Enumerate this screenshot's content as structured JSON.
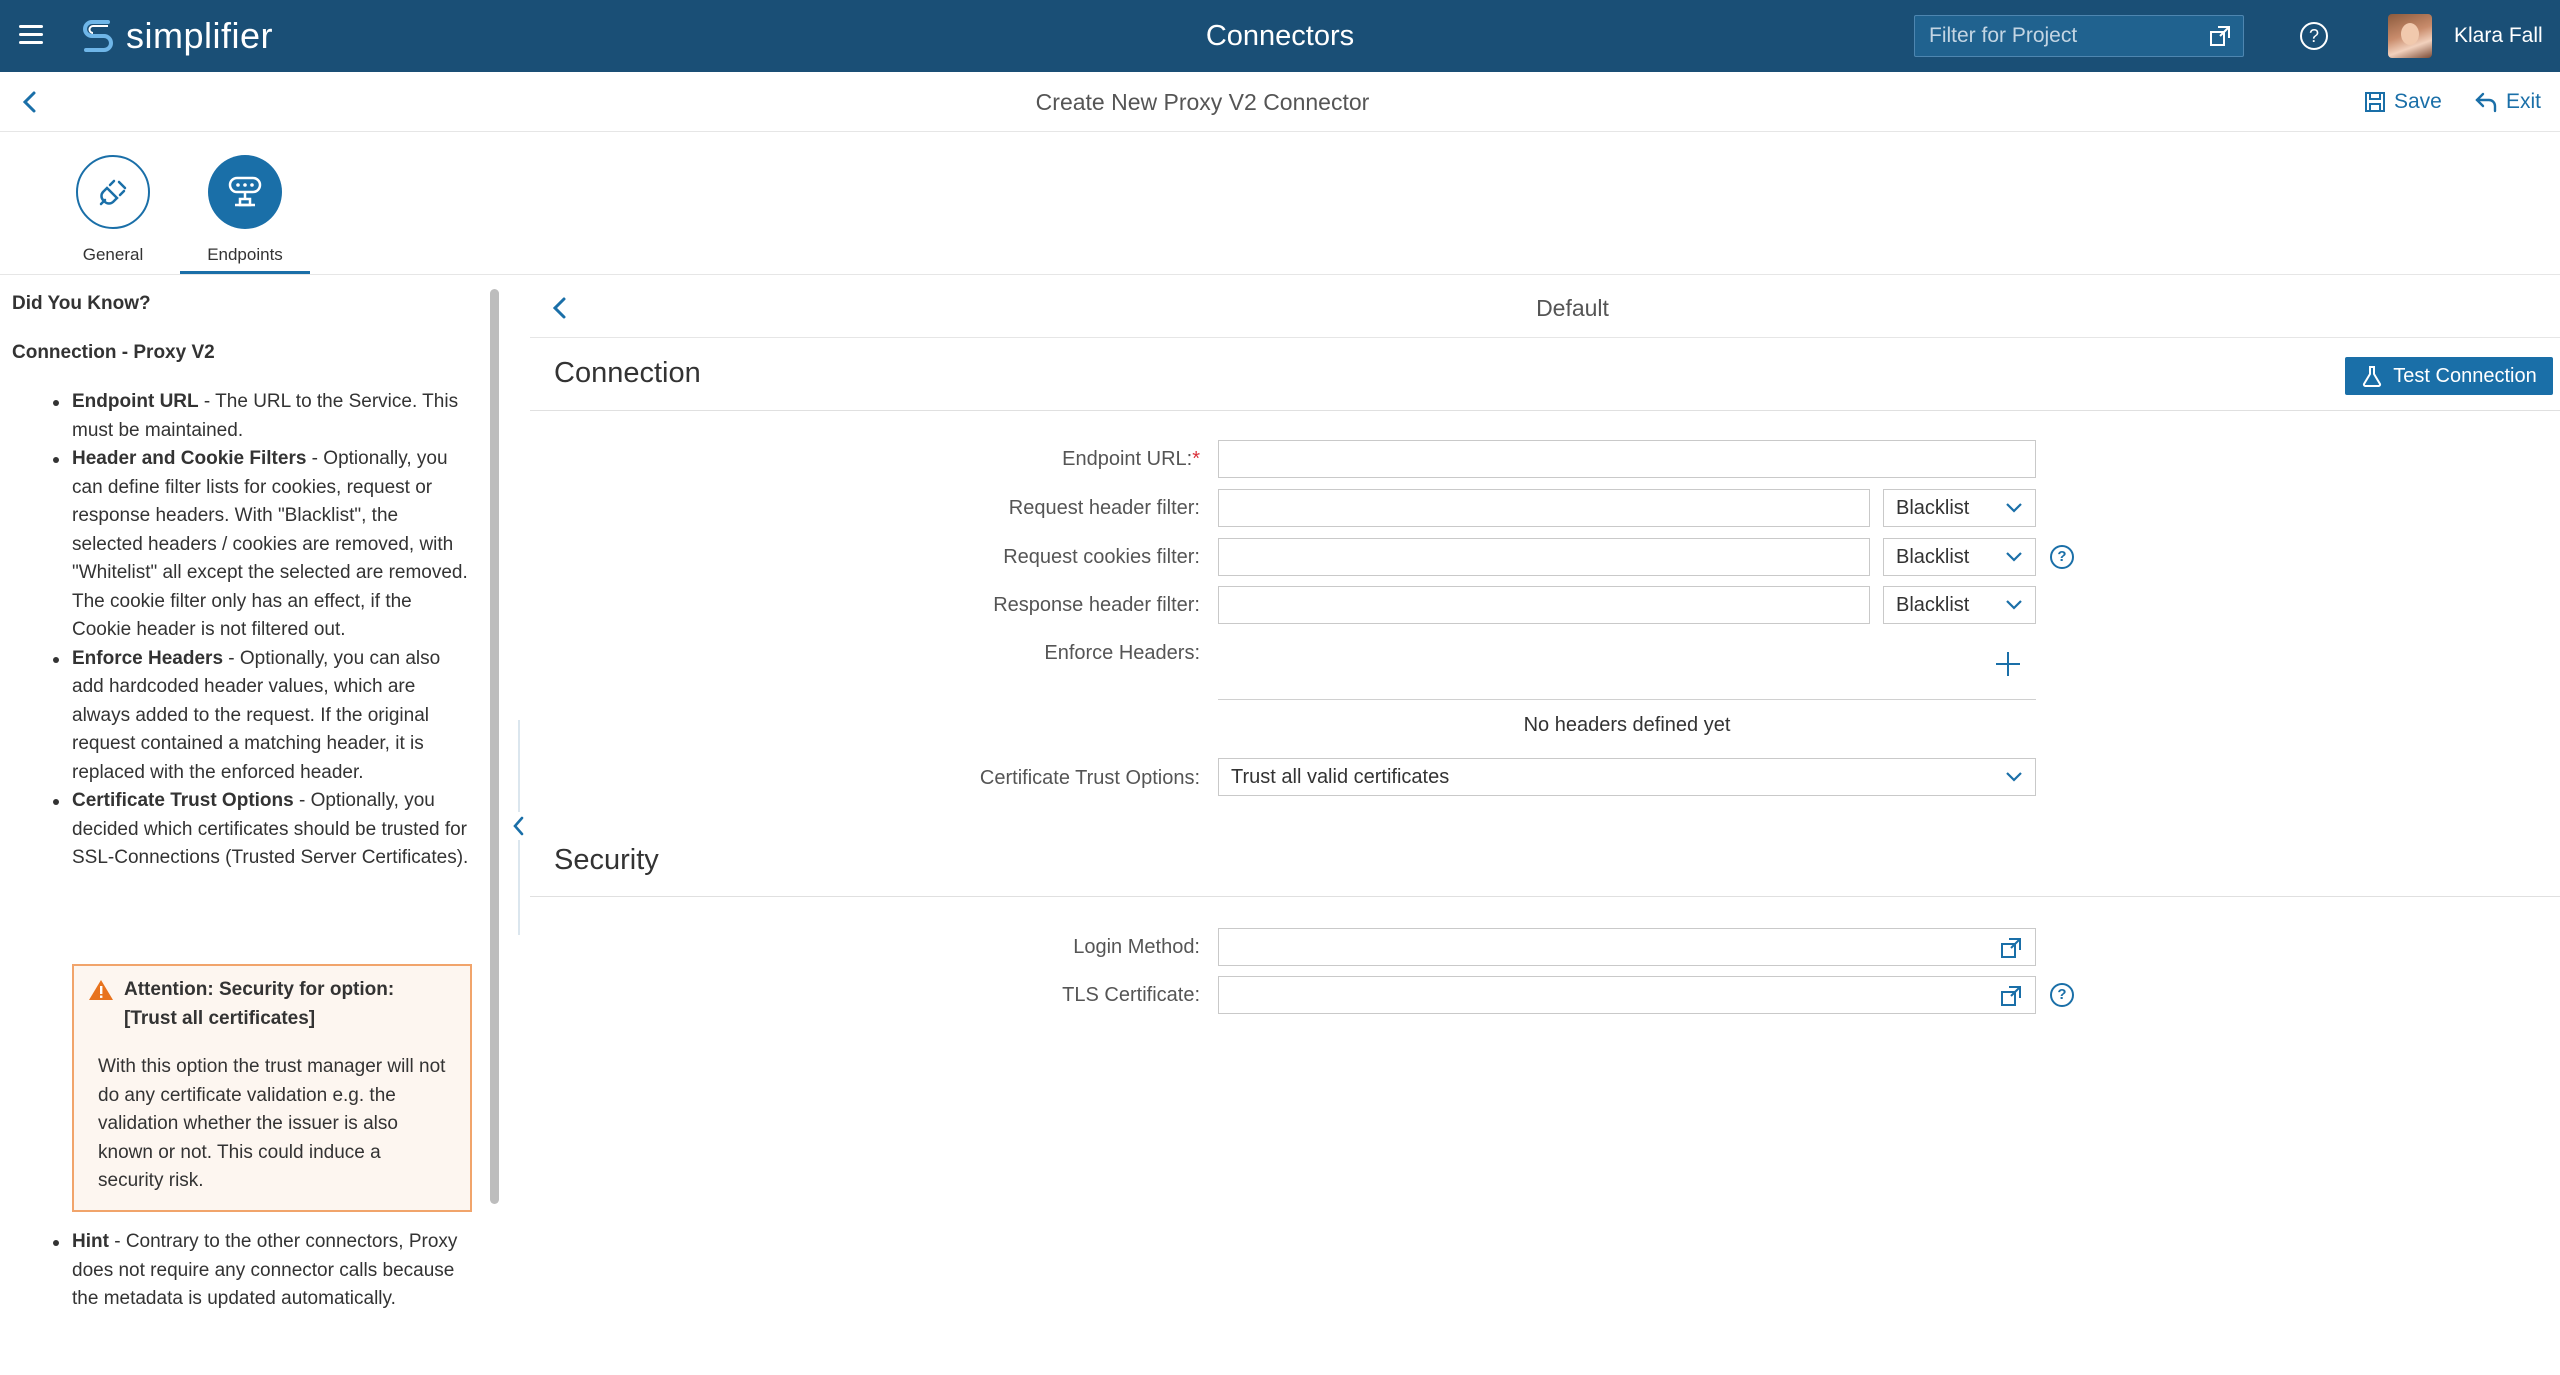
{
  "app": {
    "brand": "simplifier",
    "title": "Connectors",
    "filter_placeholder": "Filter for Project",
    "user_name": "Klara Fall"
  },
  "subheader": {
    "title": "Create New Proxy V2 Connector",
    "save_label": "Save",
    "exit_label": "Exit"
  },
  "steps": [
    {
      "label": "General",
      "active": false
    },
    {
      "label": "Endpoints",
      "active": true
    }
  ],
  "help": {
    "did_you_know": "Did You Know?",
    "heading": "Connection - Proxy V2",
    "items": [
      {
        "term": "Endpoint URL",
        "text": " - The URL to the Service. This must be maintained."
      },
      {
        "term": "Header and Cookie Filters",
        "text": " - Optionally, you can define filter lists for cookies, request or response headers. With \"Blacklist\", the selected headers / cookies are removed, with \"Whitelist\" all except the selected are removed.",
        "text2": "The cookie filter only has an effect, if the Cookie header is not filtered out."
      },
      {
        "term": "Enforce Headers",
        "text": " - Optionally, you can also add hardcoded header values, which are always added to the request. If the original request contained a matching header, it is replaced with the enforced header."
      },
      {
        "term": "Certificate Trust Options",
        "text": " - Optionally, you decided which certificates should be trusted for SSL-Connections (Trusted Server Certificates)."
      },
      {
        "term": "Hint",
        "text": " - Contrary to the other connectors, Proxy does not require any connector calls because the metadata is updated automatically."
      }
    ],
    "attention_title": "Attention: Security for option: [Trust all certificates]",
    "attention_body": "With this option the trust manager will not do any certificate validation e.g. the validation whether the issuer is also known or not. This could induce a security risk."
  },
  "main": {
    "breadcrumb": "Default",
    "connection_title": "Connection",
    "test_connection_label": "Test Connection",
    "endpoint_url_label": "Endpoint URL:",
    "endpoint_url_required": "*",
    "endpoint_url_value": "",
    "request_header_filter_label": "Request header filter:",
    "request_header_filter_value": "",
    "request_header_filter_mode": "Blacklist",
    "request_cookies_filter_label": "Request cookies filter:",
    "request_cookies_filter_value": "",
    "request_cookies_filter_mode": "Blacklist",
    "response_header_filter_label": "Response header filter:",
    "response_header_filter_value": "",
    "response_header_filter_mode": "Blacklist",
    "enforce_headers_label": "Enforce Headers:",
    "no_headers_text": "No headers defined yet",
    "cert_trust_label": "Certificate Trust Options:",
    "cert_trust_value": "Trust all valid certificates",
    "security_title": "Security",
    "login_method_label": "Login Method:",
    "login_method_value": "",
    "tls_certificate_label": "TLS Certificate:",
    "tls_certificate_value": ""
  },
  "colors": {
    "topbar": "#1a4f76",
    "accent": "#1a6fa8",
    "warning_border": "#f1a46b",
    "warning_icon": "#e8731e",
    "required": "#d9303a"
  },
  "icons": [
    "hamburger-icon",
    "simplifier-logo-icon",
    "popout-icon",
    "help-icon",
    "back-chevron-icon",
    "save-icon",
    "exit-icon",
    "general-plug-icon",
    "endpoints-icon",
    "flask-icon",
    "chevron-down-icon",
    "plus-icon",
    "warning-icon"
  ]
}
